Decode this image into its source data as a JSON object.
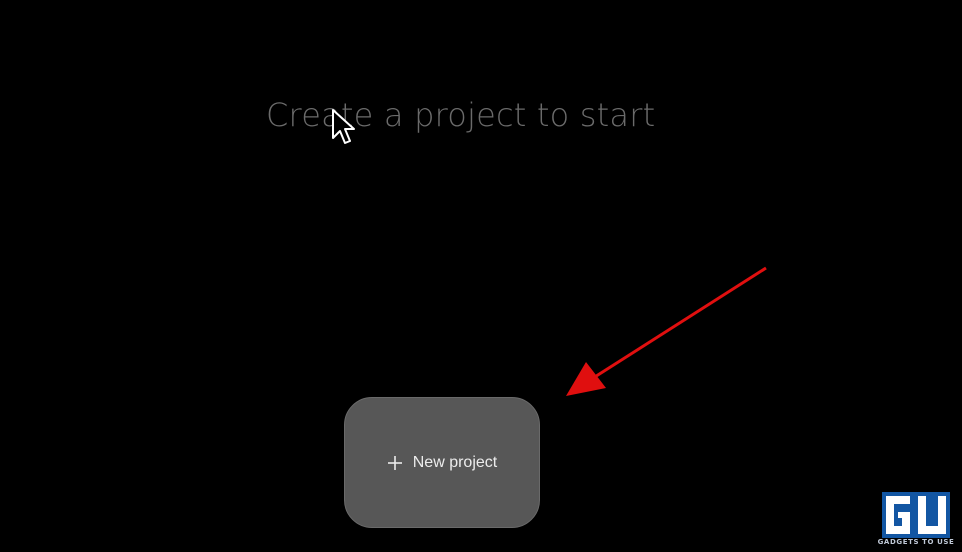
{
  "main": {
    "headline": "Create a project to start",
    "new_project_button": {
      "label": "New project",
      "icon": "plus-icon"
    }
  },
  "overlay": {
    "annotation_arrow_color": "#e00f0f",
    "cursor_icon": "mouse-pointer-icon"
  },
  "watermark": {
    "logo_text": "GU",
    "caption": "GADGETS TO USE",
    "color": "#1565c0"
  },
  "colors": {
    "background": "#000000",
    "headline_text": "#6b6b6b",
    "button_bg": "#575757",
    "button_text": "#ececec"
  }
}
